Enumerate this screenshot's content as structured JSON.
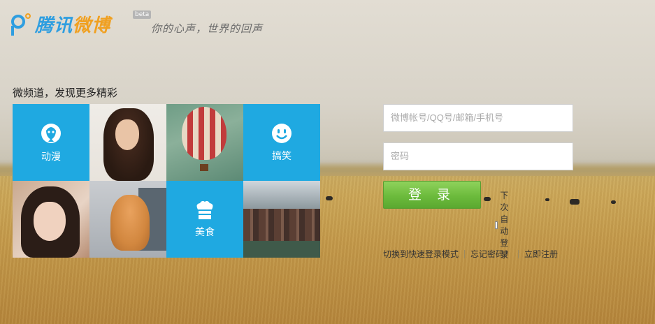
{
  "header": {
    "brand_main": "腾讯",
    "brand_accent": "微博",
    "beta": "beta",
    "slogan": "你的心声，世界的回声"
  },
  "channels": {
    "title": "微频道，发现更多精彩",
    "tiles": [
      {
        "label": "动漫",
        "icon": "anime-icon"
      },
      {
        "label": "",
        "icon": "photo"
      },
      {
        "label": "",
        "icon": "photo"
      },
      {
        "label": "搞笑",
        "icon": "smiley-icon"
      },
      {
        "label": "",
        "icon": "photo"
      },
      {
        "label": "",
        "icon": "photo"
      },
      {
        "label": "美食",
        "icon": "chef-hat-icon"
      },
      {
        "label": "",
        "icon": "photo"
      }
    ]
  },
  "login": {
    "account_placeholder": "微博帐号/QQ号/邮箱/手机号",
    "password_placeholder": "密码",
    "submit_label": "登 录",
    "remember_label": "下次自动登录"
  },
  "links": {
    "quick_login": "切换到快速登录模式",
    "forgot_password": "忘记密码？",
    "register": "立即注册"
  },
  "colors": {
    "tile_blue": "#1fa9e1",
    "brand_blue": "#2f9ee0",
    "brand_orange": "#f0a020",
    "login_green": "#6cbb3c"
  }
}
